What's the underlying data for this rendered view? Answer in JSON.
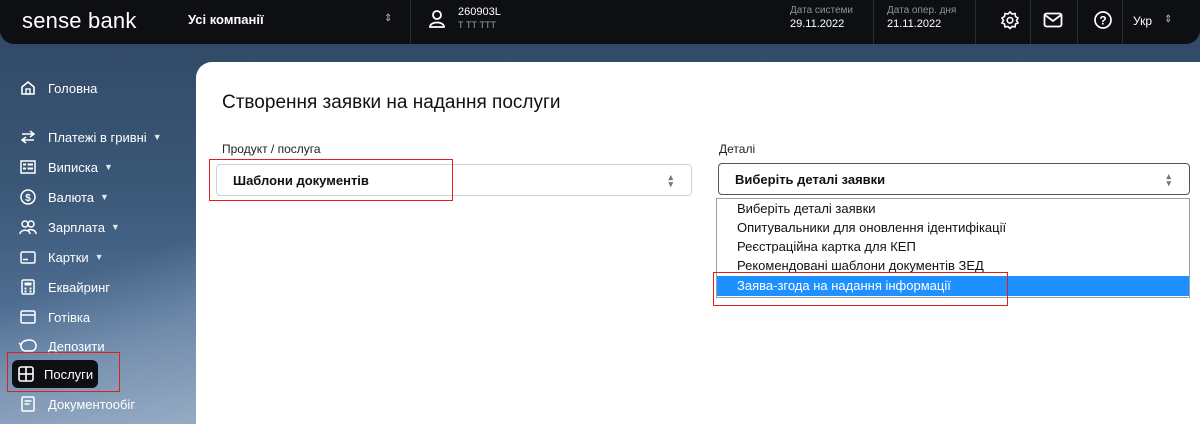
{
  "header": {
    "logo": "sense bank",
    "company": "Усі компанії",
    "user_id": "260903L",
    "user_sub": "Т ТТ ТТТ",
    "system_date_label": "Дата системи",
    "system_date": "29.11.2022",
    "oper_date_label": "Дата опер. дня",
    "oper_date": "21.11.2022",
    "lang": "Укр",
    "icons": [
      "settings-gear-icon",
      "mail-icon",
      "help-icon"
    ]
  },
  "sidebar": {
    "items": [
      {
        "label": "Головна",
        "icon": "home-icon",
        "caret": false
      },
      {
        "label": "Платежі в гривні",
        "icon": "transfer-icon",
        "caret": true
      },
      {
        "label": "Виписка",
        "icon": "statement-icon",
        "caret": true
      },
      {
        "label": "Валюта",
        "icon": "currency-icon",
        "caret": true
      },
      {
        "label": "Зарплата",
        "icon": "users-icon",
        "caret": true
      },
      {
        "label": "Картки",
        "icon": "card-icon",
        "caret": true
      },
      {
        "label": "Еквайринг",
        "icon": "terminal-icon",
        "caret": false
      },
      {
        "label": "Готівка",
        "icon": "cash-icon",
        "caret": false
      },
      {
        "label": "Депозити",
        "icon": "piggy-bank-icon",
        "caret": false
      },
      {
        "label": "Послуги",
        "icon": "grid-icon",
        "caret": false,
        "active": true
      },
      {
        "label": "Документообіг",
        "icon": "document-icon",
        "caret": false
      }
    ]
  },
  "main": {
    "title": "Створення заявки на надання послуги",
    "product_label": "Продукт / послуга",
    "product_value": "Шаблони документів",
    "details_label": "Деталі",
    "details_value": "Виберіть деталі заявки",
    "dropdown_options": [
      "Виберіть деталі заявки",
      "Опитувальники для оновлення ідентифікації",
      "Реєстраційна картка для КЕП",
      "Рекомендовані шаблони документів ЗЕД",
      "Заява-згода на надання інформації"
    ],
    "selected_index": 4
  },
  "colors": {
    "topbar": "#0d0f12",
    "highlight": "#1e90ff",
    "annotation_red": "#e0201b"
  }
}
